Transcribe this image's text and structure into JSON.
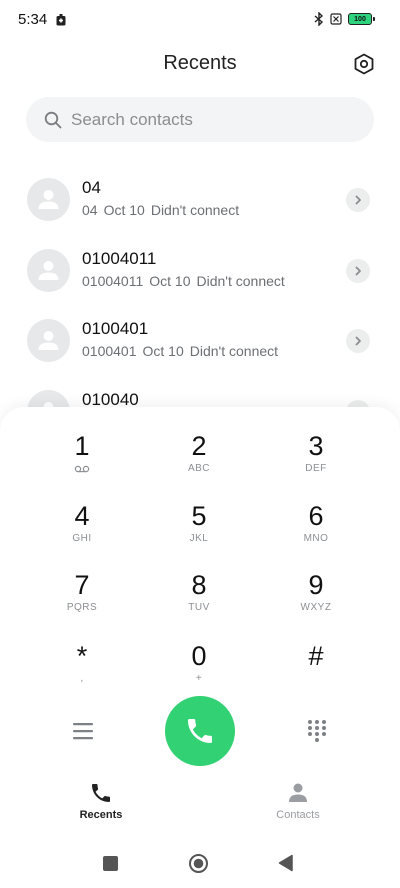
{
  "status_bar": {
    "time": "5:34",
    "battery_level": "100",
    "icons": [
      "notification-icon",
      "bluetooth-icon",
      "no-sim-icon",
      "battery-icon"
    ],
    "battery_color": "#2fd37e"
  },
  "header": {
    "title": "Recents",
    "settings_icon": "hexagon-settings-icon"
  },
  "search": {
    "placeholder": "Search contacts",
    "value": ""
  },
  "recents": [
    {
      "name": "04",
      "number": "04",
      "date": "Oct 10",
      "status": "Didn't connect"
    },
    {
      "name": "01004011",
      "number": "01004011",
      "date": "Oct 10",
      "status": "Didn't connect"
    },
    {
      "name": "0100401",
      "number": "0100401",
      "date": "Oct 10",
      "status": "Didn't connect"
    },
    {
      "name": "010040",
      "number": "",
      "date": "",
      "status": ""
    }
  ],
  "dialpad": {
    "keys": [
      {
        "digit": "1",
        "letters": ""
      },
      {
        "digit": "2",
        "letters": "ABC"
      },
      {
        "digit": "3",
        "letters": "DEF"
      },
      {
        "digit": "4",
        "letters": "GHI"
      },
      {
        "digit": "5",
        "letters": "JKL"
      },
      {
        "digit": "6",
        "letters": "MNO"
      },
      {
        "digit": "7",
        "letters": "PQRS"
      },
      {
        "digit": "8",
        "letters": "TUV"
      },
      {
        "digit": "9",
        "letters": "WXYZ"
      },
      {
        "digit": "*",
        "letters": ","
      },
      {
        "digit": "0",
        "letters": "+"
      },
      {
        "digit": "#",
        "letters": ""
      }
    ],
    "call_button_color": "#32d173"
  },
  "tabs": [
    {
      "label": "Recents",
      "icon": "phone-icon",
      "active": true
    },
    {
      "label": "Contacts",
      "icon": "person-icon",
      "active": false
    }
  ],
  "nav_bar": {
    "icons": [
      "square-recents-icon",
      "circle-home-icon",
      "triangle-back-icon"
    ]
  }
}
